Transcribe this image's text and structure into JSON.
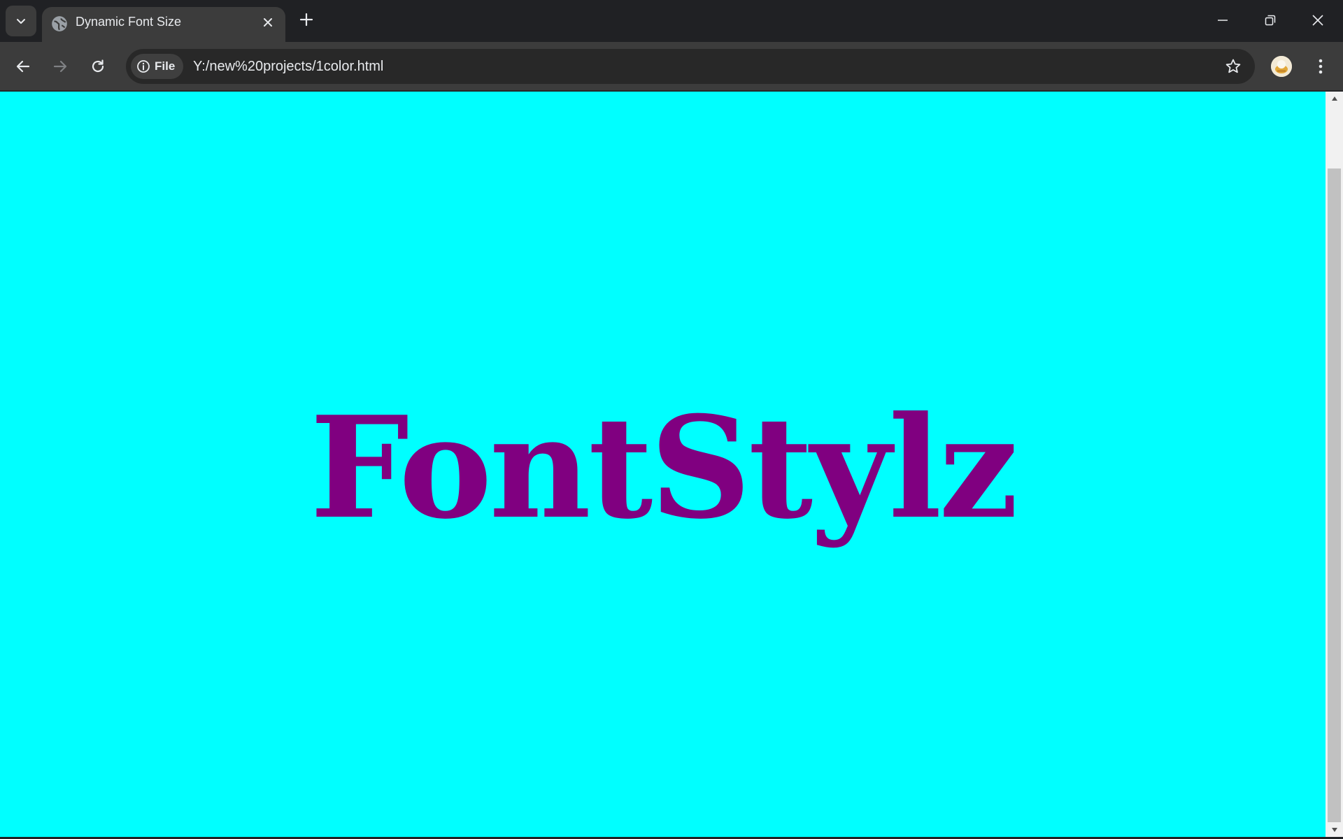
{
  "browser": {
    "tab": {
      "title": "Dynamic Font Size",
      "favicon": "globe-icon"
    },
    "address_bar": {
      "site_chip_label": "File",
      "url": "Y:/new%20projects/1color.html"
    },
    "colors": {
      "frame": "#202124",
      "toolbar": "#3c3c3c",
      "omnibox": "#282828"
    }
  },
  "page": {
    "headline": "FontStylz",
    "background_color": "#00ffff",
    "text_color": "#800080"
  }
}
